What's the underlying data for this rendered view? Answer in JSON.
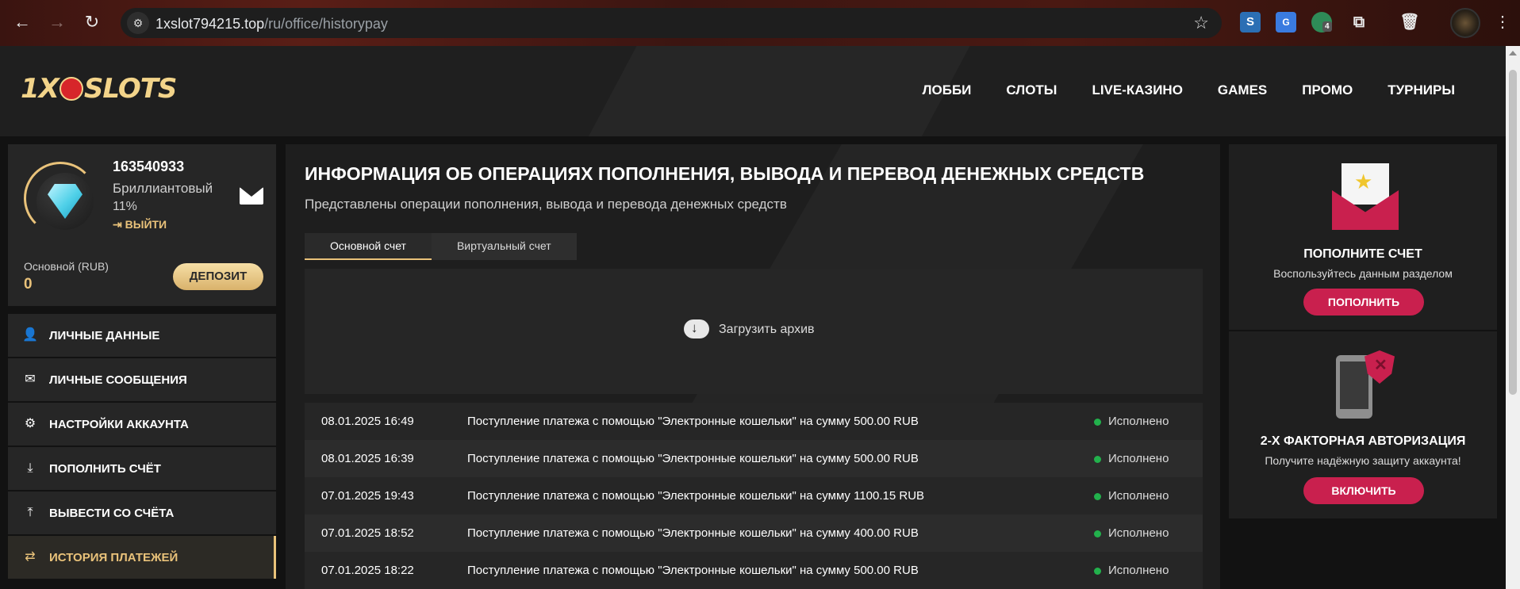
{
  "browser": {
    "url_host": "1xslot794215.top",
    "url_path": "/ru/office/historypay",
    "extension_badge": "4"
  },
  "site": {
    "logo_text_left": "1X",
    "logo_text_right": "SLOTS",
    "nav": [
      "ЛОББИ",
      "СЛОТЫ",
      "LIVE-КАЗИНО",
      "GAMES",
      "ПРОМО",
      "ТУРНИРЫ"
    ]
  },
  "profile": {
    "user_id": "163540933",
    "level": "Бриллиантовый",
    "percent": "11%",
    "logout_label": "ВЫЙТИ",
    "balance_label": "Основной (RUB)",
    "balance_value": "0",
    "deposit_label": "ДЕПОЗИТ"
  },
  "side_menu": [
    {
      "label": "ЛИЧНЫЕ ДАННЫЕ",
      "icon": "user-plus-icon",
      "active": false
    },
    {
      "label": "ЛИЧНЫЕ СООБЩЕНИЯ",
      "icon": "envelope-icon",
      "active": false
    },
    {
      "label": "НАСТРОЙКИ АККАУНТА",
      "icon": "gears-icon",
      "active": false
    },
    {
      "label": "ПОПОЛНИТЬ СЧЁТ",
      "icon": "download-icon",
      "active": false
    },
    {
      "label": "ВЫВЕСТИ СО СЧЁТА",
      "icon": "upload-icon",
      "active": false
    },
    {
      "label": "ИСТОРИЯ ПЛАТЕЖЕЙ",
      "icon": "exchange-icon",
      "active": true
    }
  ],
  "main": {
    "title": "ИНФОРМАЦИЯ ОБ ОПЕРАЦИЯХ ПОПОЛНЕНИЯ, ВЫВОДА И ПЕРЕВОД ДЕНЕЖНЫХ СРЕДСТВ",
    "subtitle": "Представлены операции пополнения, вывода и перевода денежных средств",
    "tabs": [
      {
        "label": "Основной счет",
        "active": true
      },
      {
        "label": "Виртуальный счет",
        "active": false
      }
    ],
    "upload_label": "Загрузить архив",
    "history": [
      {
        "date": "08.01.2025 16:49",
        "desc": "Поступление платежа с помощью \"Электронные кошельки\" на сумму 500.00 RUB",
        "status": "Исполнено"
      },
      {
        "date": "08.01.2025 16:39",
        "desc": "Поступление платежа с помощью \"Электронные кошельки\" на сумму 500.00 RUB",
        "status": "Исполнено"
      },
      {
        "date": "07.01.2025 19:43",
        "desc": "Поступление платежа с помощью \"Электронные кошельки\" на сумму 1100.15 RUB",
        "status": "Исполнено"
      },
      {
        "date": "07.01.2025 18:52",
        "desc": "Поступление платежа с помощью \"Электронные кошельки\" на сумму 400.00 RUB",
        "status": "Исполнено"
      },
      {
        "date": "07.01.2025 18:22",
        "desc": "Поступление платежа с помощью \"Электронные кошельки\" на сумму 500.00 RUB",
        "status": "Исполнено"
      }
    ],
    "status_color": "#22b14c"
  },
  "right": {
    "topup": {
      "title": "ПОПОЛНИТЕ СЧЕТ",
      "text": "Воспользуйтесь данным разделом",
      "button": "ПОПОЛНИТЬ"
    },
    "twofa": {
      "title": "2-Х ФАКТОРНАЯ АВТОРИЗАЦИЯ",
      "text": "Получите надёжную защиту аккаунта!",
      "button": "ВКЛЮЧИТЬ"
    }
  },
  "colors": {
    "accent_gold": "#e9c27a",
    "accent_pink": "#c9204e"
  }
}
